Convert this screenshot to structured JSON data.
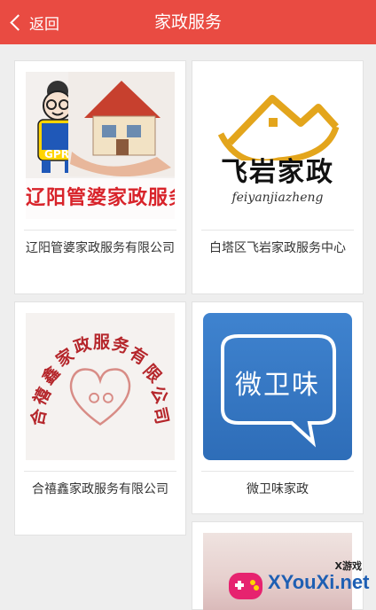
{
  "header": {
    "back_label": "返回",
    "title": "家政服务",
    "color": "#e94b42"
  },
  "listings": [
    {
      "name": "辽阳管婆家政服务有限公司",
      "image": {
        "banner_text": "辽阳管婆家政服务",
        "badge": "GPR"
      }
    },
    {
      "name": "白塔区飞岩家政服务中心",
      "image": {
        "title": "飞岩家政",
        "subtitle": "feiyanjiazheng"
      }
    },
    {
      "name": "合禧鑫家政服务有限公司",
      "image": {
        "arc_text": "合禧鑫家政服务有限公司"
      }
    },
    {
      "name": "微卫味家政",
      "image": {
        "title": "微卫味"
      }
    },
    {
      "name": "",
      "image": {}
    }
  ],
  "watermark": {
    "small": "X游戏",
    "main": "XYouXi.net"
  }
}
